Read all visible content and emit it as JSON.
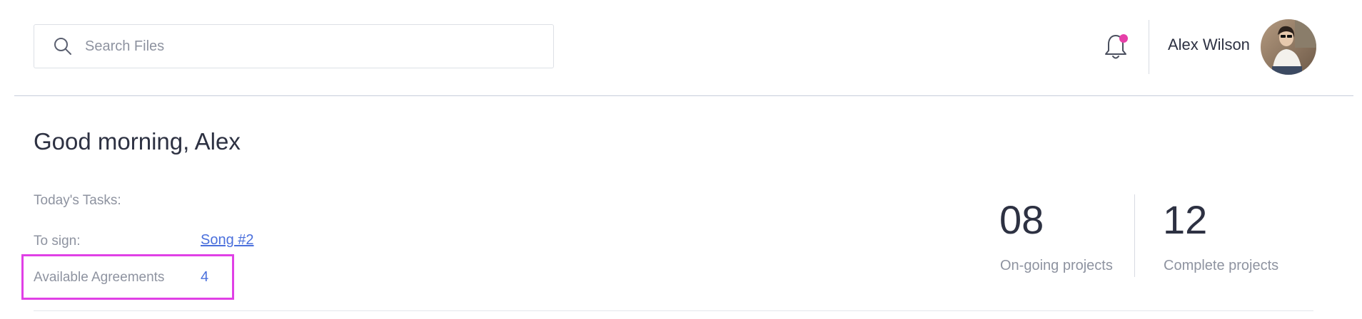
{
  "header": {
    "search": {
      "placeholder": "Search Files",
      "value": ""
    },
    "notifications": {
      "icon": "bell-icon",
      "has_unread": true,
      "badge_color": "#e63fa8"
    },
    "user": {
      "name": "Alex Wilson",
      "avatar_icon": "user-avatar"
    }
  },
  "main": {
    "greeting": "Good morning, Alex",
    "tasks_label": "Today's Tasks:",
    "to_sign": {
      "label": "To sign:",
      "value": "Song #2"
    },
    "available_agreements": {
      "label": "Available Agreements",
      "value": "4"
    },
    "stats": [
      {
        "value": "08",
        "label": "On-going projects"
      },
      {
        "value": "12",
        "label": "Complete projects"
      }
    ]
  },
  "colors": {
    "accent": "#4a6fdc",
    "highlight": "#e040e6",
    "text": "#2d3142",
    "muted": "#8e93a0"
  }
}
